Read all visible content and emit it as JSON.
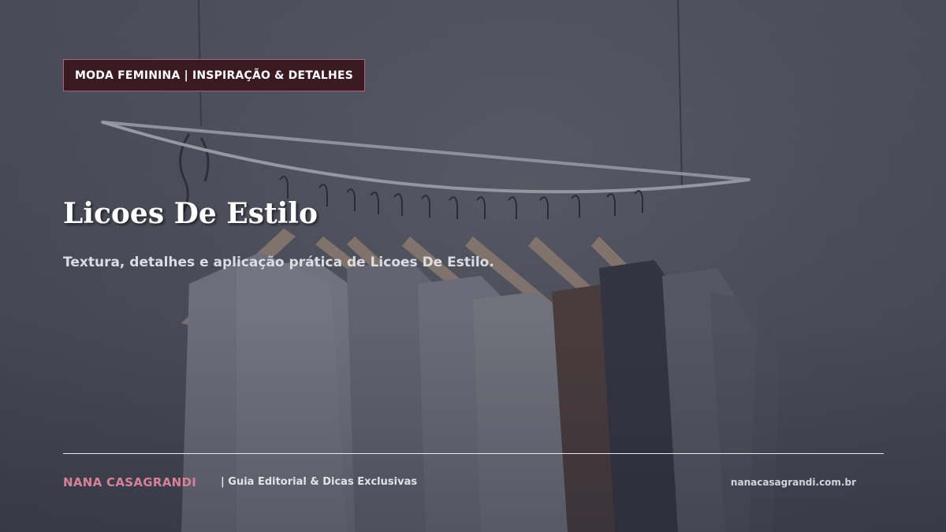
{
  "header": {
    "badge": "MODA FEMININA | INSPIRAÇÃO & DETALHES"
  },
  "main": {
    "title": "Licoes De Estilo",
    "subtitle": "Textura, detalhes e aplicação prática de Licoes De Estilo."
  },
  "footer": {
    "brand": "NANA CASAGRANDI",
    "tagline": "|  Guia Editorial & Dicas Exclusivas",
    "url": "nanacasagrandi.com.br"
  },
  "colors": {
    "badge_bg": "#3a1a22",
    "badge_border": "#b0607a",
    "brand_accent": "#d98099",
    "background": "#5a5c66"
  }
}
